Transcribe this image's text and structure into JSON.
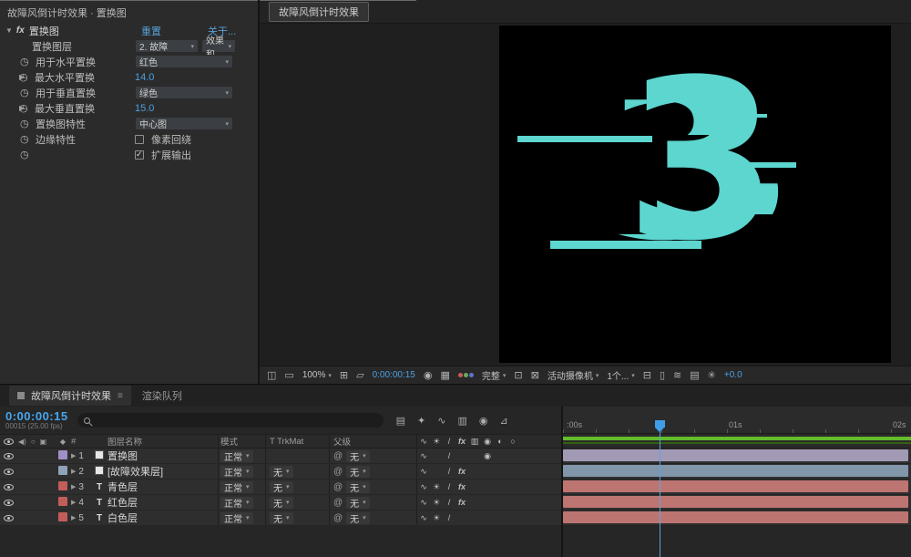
{
  "colors": {
    "accent_blue": "#45a6ef",
    "link_blue": "#579fd6",
    "digit_cyan": "#5cd6cf",
    "cache_green": "#63bd2b"
  },
  "icons": {
    "stopwatch": "◷",
    "dropdown_arrow": "▾",
    "expander": "▶",
    "text_layer": "T",
    "switches": {
      "shy": "∿",
      "star": "☀",
      "quality": "/",
      "fx": "fx",
      "motion-blur": "◉"
    }
  },
  "effect_controls": {
    "panel_title": "故障风倒计时效果 · 置换图",
    "effect": {
      "name": "置换图",
      "reset": "重置",
      "about": "关于..."
    },
    "properties": {
      "map_layer_label": "置换图层",
      "map_layer_value": "2. 故障",
      "map_source_value": "效果和",
      "h_use_label": "用于水平置换",
      "h_use_value": "红色",
      "h_max_label": "最大水平置换",
      "h_max_value": "14.0",
      "v_use_label": "用于垂直置换",
      "v_use_value": "绿色",
      "v_max_label": "最大垂直置换",
      "v_max_value": "15.0",
      "behavior_label": "置换图特性",
      "behavior_value": "中心图",
      "edge_label": "边缘特性",
      "edge_option": "像素回绕",
      "expand_option": "扩展输出"
    }
  },
  "viewer": {
    "tab": "故障风倒计时效果",
    "digit": "3",
    "toolbar": {
      "zoom": "100%",
      "timecode": "0:00:00:15",
      "resolution": "完整",
      "camera": "活动摄像机",
      "views": "1个...",
      "exposure": "+0.0"
    }
  },
  "timeline": {
    "tab_active": "故障风倒计时效果",
    "tab_render_queue": "渲染队列",
    "timecode": "0:00:00:15",
    "frame_info": "00015 (25.00 fps)",
    "columns": {
      "name": "图层名称",
      "mode": "模式",
      "trkmat": "T TrkMat",
      "parent": "父级"
    },
    "ruler": [
      ":00s",
      "01s",
      "02s"
    ],
    "layers": [
      {
        "num": "1",
        "type": "solid",
        "label_color": "#9f8fc6",
        "name": "置换图",
        "mode": "正常",
        "trkmat": "",
        "parent": "无",
        "switches": [
          "shy",
          "",
          "quality",
          "",
          "",
          "motion-blur",
          "",
          ""
        ],
        "bar_color": "#a29ab4"
      },
      {
        "num": "2",
        "type": "solid",
        "label_color": "#8fa3b8",
        "name": "[故障效果层]",
        "mode": "正常",
        "trkmat": "无",
        "parent": "无",
        "switches": [
          "shy",
          "",
          "quality",
          "fx",
          "",
          "",
          "",
          ""
        ],
        "bar_color": "#8296aa"
      },
      {
        "num": "3",
        "type": "text",
        "label_color": "#c35d5a",
        "name": "青色层",
        "mode": "正常",
        "trkmat": "无",
        "parent": "无",
        "switches": [
          "shy",
          "star",
          "quality",
          "fx",
          "",
          "",
          "",
          ""
        ],
        "bar_color": "#bd7572"
      },
      {
        "num": "4",
        "type": "text",
        "label_color": "#c35d5a",
        "name": "红色层",
        "mode": "正常",
        "trkmat": "无",
        "parent": "无",
        "switches": [
          "shy",
          "star",
          "quality",
          "fx",
          "",
          "",
          "",
          ""
        ],
        "bar_color": "#bd7572"
      },
      {
        "num": "5",
        "type": "text",
        "label_color": "#c35d5a",
        "name": "白色层",
        "mode": "正常",
        "trkmat": "无",
        "parent": "无",
        "switches": [
          "shy",
          "star",
          "quality",
          "",
          "",
          "",
          "",
          ""
        ],
        "bar_color": "#bd7572"
      }
    ]
  }
}
